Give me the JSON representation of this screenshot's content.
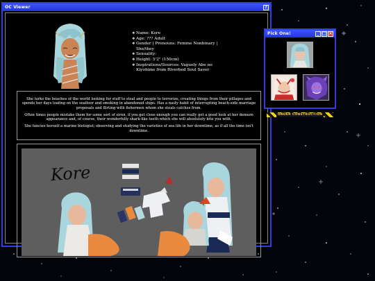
{
  "main_window": {
    "title": "OC Viewer",
    "help_label": "?"
  },
  "character": {
    "stats": [
      "Name: Kore",
      "Age: ??? Adult",
      "Gender | Pronouns: Femme Nonbinary | She/they",
      "Sexuality:",
      "Height: 5'2\" (150cm)",
      "Inspirations/Sources: Vaguely Abe no Kiyohime from Riverbed Soul Saver"
    ],
    "bio": [
      "She lurks the beaches of the world looking for stuff to steal and people to terrorize, creating things from their pillages and spends her days loafing on the seafloor and smoking in abandoned ships. Has a nasty habit of interrupting beach-side marriage proposals and flirting with fishermen whom she steals catches from.",
      "Often times people mistake them for some sort of siren, if you get close enough you can really get a good look at her demure appearance and, of course, their wonderfully shark-like teeth which she will absolutely bite you with.",
      "She fancies herself a marine biologist; observing and studying the varieties of sea life in her downtime, as if all the time isn't downtime."
    ],
    "art_signature": "Kore"
  },
  "pick_window": {
    "title": "Pick One!",
    "minimize_label": "_",
    "maximize_label": "□",
    "close_label": "×"
  },
  "banner": {
    "text": "UNDER CONSTRUCTION"
  },
  "colors": {
    "window_border": "#2f3fe0",
    "titlebar": "#3d54ff",
    "hair": "#a9d6dc",
    "tail": "#e98a3e",
    "construction_yellow": "#f2d21a"
  }
}
